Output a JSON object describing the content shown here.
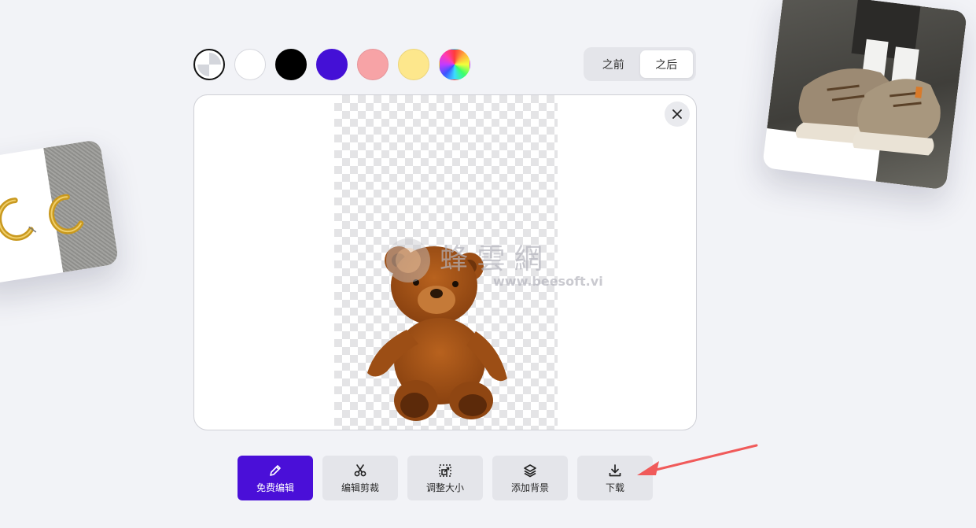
{
  "colors": {
    "accent": "#4a0fd8",
    "arrow": "#f05a5a"
  },
  "swatches": [
    {
      "name": "transparent",
      "color": "transparent",
      "active": true
    },
    {
      "name": "white",
      "color": "#ffffff",
      "active": false
    },
    {
      "name": "black",
      "color": "#000000",
      "active": false
    },
    {
      "name": "purple",
      "color": "#4410d6",
      "active": false
    },
    {
      "name": "pink",
      "color": "#f7a3a6",
      "active": false
    },
    {
      "name": "yellow",
      "color": "#fde78c",
      "active": false
    },
    {
      "name": "custom",
      "color": "rainbow",
      "active": false
    }
  ],
  "toggle": {
    "before_label": "之前",
    "after_label": "之后",
    "selected": "after"
  },
  "preview": {
    "watermark_text": "蜂 雲 網",
    "watermark_url": "www.beesoft.vip"
  },
  "toolbar": {
    "edit_label": "免费编辑",
    "crop_label": "编辑剪裁",
    "resize_label": "调整大小",
    "background_label": "添加背景",
    "download_label": "下载"
  },
  "icons": {
    "close": "close-icon",
    "edit": "pencil-icon",
    "crop": "scissors-icon",
    "resize": "resize-icon",
    "background": "layers-icon",
    "download": "download-icon"
  }
}
